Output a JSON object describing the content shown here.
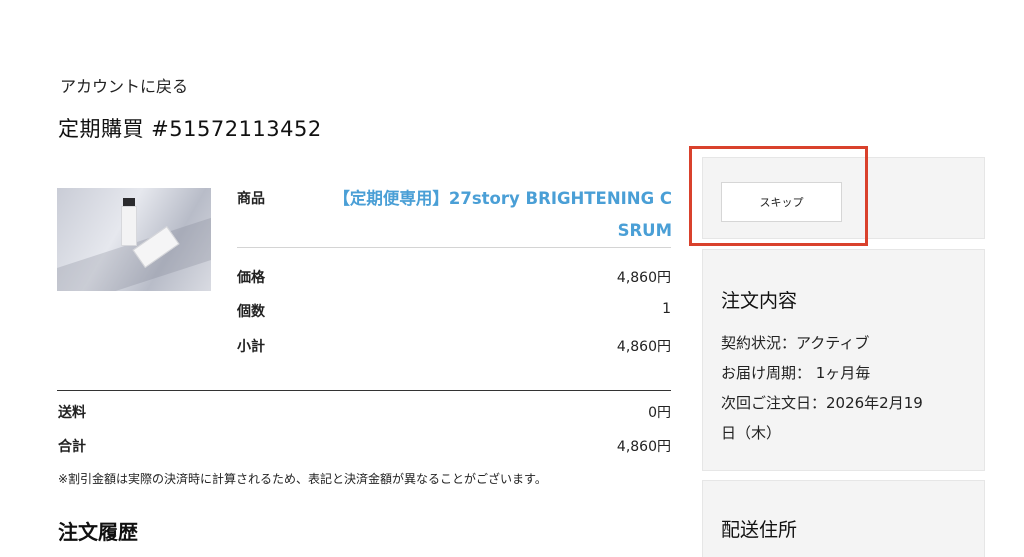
{
  "nav": {
    "back_label": "アカウントに戻る"
  },
  "page": {
    "title": "定期購買 #51572113452"
  },
  "product": {
    "label_product": "商品",
    "name": "【定期便専用】27story BRIGHTENING C SRUM",
    "label_price": "価格",
    "price": "4,860円",
    "label_quantity": "個数",
    "quantity": "1",
    "label_subtotal": "小計",
    "subtotal": "4,860円"
  },
  "totals": {
    "label_shipping": "送料",
    "shipping": "0円",
    "label_total": "合計",
    "total": "4,860円",
    "note": "※割引金額は実際の決済時に計算されるため、表記と決済金額が異なることがございます。"
  },
  "history": {
    "title": "注文履歴"
  },
  "sidebar": {
    "skip_label": "スキップ",
    "order_title": "注文内容",
    "contract_status": "契約状況：アクティブ",
    "delivery_cycle": "お届け周期： 1ヶ月毎",
    "next_order_line1": "次回ご注文日：2026年2月19",
    "next_order_line2": "日（木）",
    "address_title": "配送住所"
  },
  "colors": {
    "accent_link": "#4a9fd6",
    "highlight": "#d9412c",
    "panel_bg": "#f4f4f4"
  }
}
